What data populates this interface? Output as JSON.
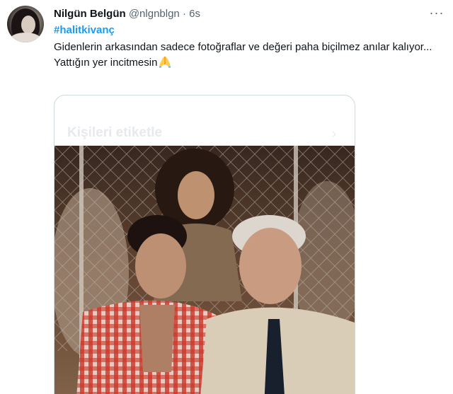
{
  "tweet": {
    "display_name": "Nilgün Belgün",
    "handle": "@nlgnblgn",
    "separator": "·",
    "timestamp": "6s",
    "more_label": "···",
    "hashtag": "#halitkivanç",
    "text_line1": "Gidenlerin arkasından sadece fotoğraflar ve değeri paha biçilmez anılar kalıyor...",
    "text_line2": "Yattığın yer incitmesin"
  },
  "media": {
    "overlay_label": "Kişileri etiketle",
    "overlay_chevron": "›"
  },
  "icons": {
    "more": "more-horizontal-icon",
    "pray": "folded-hands-emoji-icon"
  },
  "colors": {
    "accent": "#1d9bf0",
    "text": "#0f1419",
    "secondary": "#536471",
    "border": "#cfd9de"
  }
}
